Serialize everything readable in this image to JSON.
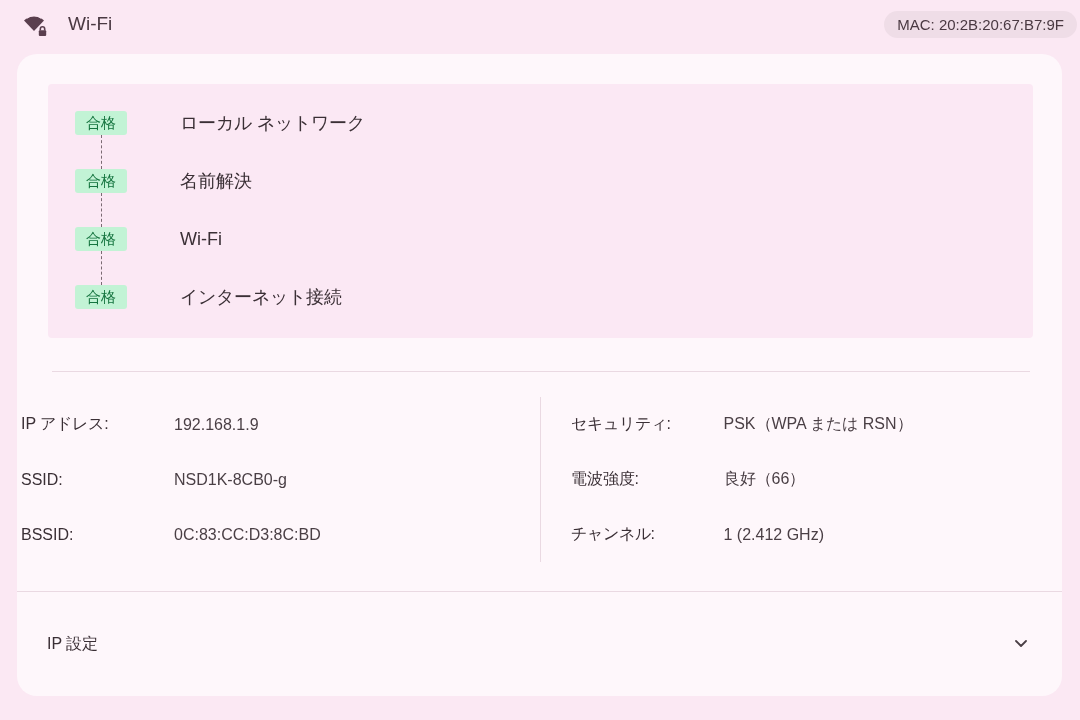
{
  "header": {
    "title": "Wi-Fi",
    "mac": "MAC: 20:2B:20:67:B7:9F"
  },
  "diagnostics": [
    {
      "status": "合格",
      "kind": "pass",
      "label": "ローカル ネットワーク"
    },
    {
      "status": "合格",
      "kind": "pass",
      "label": "名前解決"
    },
    {
      "status": "合格",
      "kind": "pass",
      "label": "Wi-Fi"
    },
    {
      "status": "合格",
      "kind": "pass",
      "label": "インターネット接続"
    }
  ],
  "details": {
    "columns": [
      {
        "rows": [
          {
            "label": "IP アドレス:",
            "value": "192.168.1.9"
          },
          {
            "label": "SSID:",
            "value": "NSD1K-8CB0-g"
          },
          {
            "label": "BSSID:",
            "value": "0C:83:CC:D3:8C:BD"
          }
        ]
      },
      {
        "rows": [
          {
            "label": "セキュリティ:",
            "value": "PSK（WPA または RSN）"
          },
          {
            "label": "電波強度:",
            "value": "良好（66）"
          },
          {
            "label": "チャンネル:",
            "value": "1 (2.412 GHz)"
          }
        ]
      }
    ]
  },
  "ip_settings": {
    "label": "IP 設定",
    "expanded": false
  }
}
